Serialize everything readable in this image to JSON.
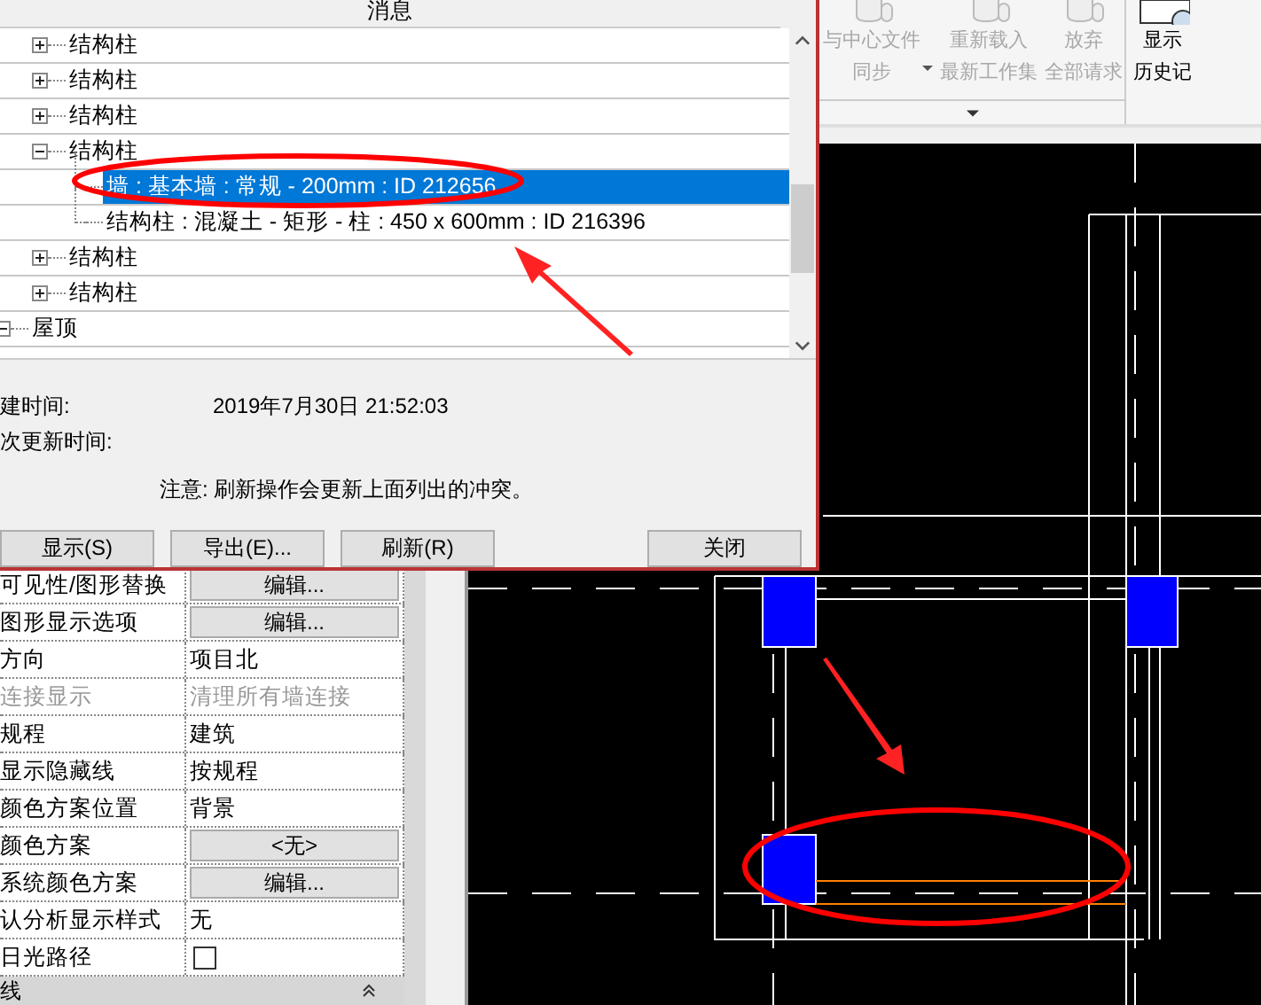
{
  "ribbon": {
    "buttons": [
      {
        "lines": [
          "与中心文件",
          "同步"
        ],
        "disabled": true,
        "dropdown": true
      },
      {
        "lines": [
          "重新载入",
          "最新工作集"
        ],
        "disabled": true,
        "dropdown": false
      },
      {
        "lines": [
          "放弃",
          "全部请求"
        ],
        "disabled": true,
        "dropdown": false
      },
      {
        "lines": [
          "显示",
          "历史记"
        ],
        "disabled": false,
        "dropdown": false
      }
    ]
  },
  "properties": {
    "rows": [
      {
        "kind": "button",
        "label": "可见性/图形替换",
        "value": "编辑...",
        "disabled": false
      },
      {
        "kind": "button",
        "label": "图形显示选项",
        "value": "编辑...",
        "disabled": false
      },
      {
        "kind": "text",
        "label": "方向",
        "value": "项目北",
        "disabled": false
      },
      {
        "kind": "text",
        "label": "连接显示",
        "value": "清理所有墙连接",
        "disabled": true
      },
      {
        "kind": "text",
        "label": "规程",
        "value": "建筑",
        "disabled": false
      },
      {
        "kind": "text",
        "label": "显示隐藏线",
        "value": "按规程",
        "disabled": false
      },
      {
        "kind": "text",
        "label": "颜色方案位置",
        "value": "背景",
        "disabled": false
      },
      {
        "kind": "button",
        "label": "颜色方案",
        "value": "<无>",
        "disabled": false
      },
      {
        "kind": "button",
        "label": "系统颜色方案",
        "value": "编辑...",
        "disabled": false
      },
      {
        "kind": "text",
        "label": "认分析显示样式",
        "value": "无",
        "disabled": false
      },
      {
        "kind": "checkbox",
        "label": "日光路径",
        "checked": false,
        "disabled": false
      }
    ],
    "section": {
      "title": "线",
      "expanded": true
    }
  },
  "dialog": {
    "title": "消息",
    "tree": [
      {
        "children": [
          {
            "label": "结构柱",
            "expanded": false,
            "selected": false
          },
          {
            "label": "结构柱",
            "expanded": false,
            "selected": false
          },
          {
            "label": "结构柱",
            "expanded": false,
            "selected": false
          },
          {
            "label": "结构柱",
            "expanded": true,
            "selected": false,
            "children": [
              {
                "label": "墙 : 基本墙 : 常规 - 200mm : ID 212656",
                "selected": true
              },
              {
                "label": "结构柱 : 混凝土 - 矩形 - 柱 : 450 x 600mm : ID 216396",
                "selected": false
              }
            ]
          },
          {
            "label": "结构柱",
            "expanded": false,
            "selected": false
          },
          {
            "label": "结构柱",
            "expanded": false,
            "selected": false
          }
        ]
      },
      {
        "label": "屋顶",
        "expanded": true,
        "selected": false
      }
    ],
    "created_label": "建时间:",
    "created_value": "2019年7月30日 21:52:03",
    "updated_label": "次更新时间:",
    "note": "注意: 刷新操作会更新上面列出的冲突。",
    "buttons": [
      "显示(S)",
      "导出(E)...",
      "刷新(R)",
      "关闭"
    ]
  }
}
